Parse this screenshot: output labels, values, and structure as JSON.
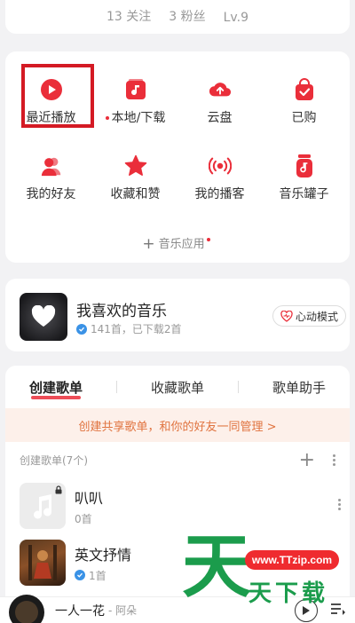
{
  "profile_stats": {
    "follows": "13 关注",
    "fans": "3 粉丝",
    "level": "Lv.9"
  },
  "quick_grid": [
    {
      "label": "最近播放",
      "icon": "play-circle-icon"
    },
    {
      "label": "本地/下载",
      "icon": "local-music-icon"
    },
    {
      "label": "云盘",
      "icon": "cloud-upload-icon"
    },
    {
      "label": "已购",
      "icon": "purchased-bag-icon"
    },
    {
      "label": "我的好友",
      "icon": "friends-icon"
    },
    {
      "label": "收藏和赞",
      "icon": "star-icon"
    },
    {
      "label": "我的播客",
      "icon": "podcast-icon"
    },
    {
      "label": "音乐罐子",
      "icon": "music-jar-icon"
    }
  ],
  "music_apps": {
    "label": "音乐应用"
  },
  "favorite": {
    "title": "我喜欢的音乐",
    "subtitle": "141首，已下载2首",
    "mode_button": "心动模式"
  },
  "tabs": [
    "创建歌单",
    "收藏歌单",
    "歌单助手"
  ],
  "banner": "创建共享歌单，和你的好友一同管理 >",
  "created_section": {
    "title": "创建歌单(7个)"
  },
  "playlists": [
    {
      "name": "叭叭",
      "count": "0首"
    },
    {
      "name": "英文抒情",
      "count": "1首"
    }
  ],
  "player": {
    "title": "一人一花",
    "artist": "- 阿朵"
  },
  "watermark": {
    "url": "www.TTzip.com",
    "big": "天",
    "text": "天下载"
  },
  "colors": {
    "accent": "#ea2e3a",
    "banner_text": "#e0733f",
    "watermark_green": "#1b9c4c"
  }
}
